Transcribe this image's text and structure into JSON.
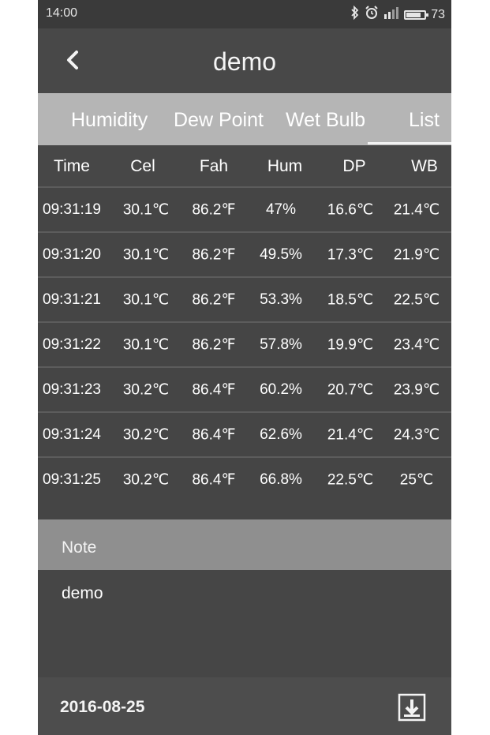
{
  "status_bar": {
    "time": "14:00",
    "battery_level": "73",
    "icons": [
      "bluetooth-icon",
      "alarm-icon",
      "signal-icon",
      "battery-icon"
    ]
  },
  "header": {
    "title": "demo"
  },
  "tabs": [
    {
      "label": "Humidity"
    },
    {
      "label": "Dew Point"
    },
    {
      "label": "Wet Bulb"
    },
    {
      "label": "List",
      "selected": true
    }
  ],
  "table": {
    "columns": [
      "Time",
      "Cel",
      "Fah",
      "Hum",
      "DP",
      "WB"
    ],
    "rows": [
      [
        "09:31:19",
        "30.1℃",
        "86.2℉",
        "47%",
        "16.6℃",
        "21.4℃"
      ],
      [
        "09:31:20",
        "30.1℃",
        "86.2℉",
        "49.5%",
        "17.3℃",
        "21.9℃"
      ],
      [
        "09:31:21",
        "30.1℃",
        "86.2℉",
        "53.3%",
        "18.5℃",
        "22.5℃"
      ],
      [
        "09:31:22",
        "30.1℃",
        "86.2℉",
        "57.8%",
        "19.9℃",
        "23.4℃"
      ],
      [
        "09:31:23",
        "30.2℃",
        "86.4℉",
        "60.2%",
        "20.7℃",
        "23.9℃"
      ],
      [
        "09:31:24",
        "30.2℃",
        "86.4℉",
        "62.6%",
        "21.4℃",
        "24.3℃"
      ],
      [
        "09:31:25",
        "30.2℃",
        "86.4℉",
        "66.8%",
        "22.5℃",
        "25℃"
      ]
    ]
  },
  "note": {
    "label": "Note",
    "text": "demo"
  },
  "footer": {
    "date": "2016-08-25"
  },
  "colors": {
    "background": "#454545",
    "tab_bar": "#b5b5b5",
    "note_header": "#8f8f8f",
    "text": "#ffffff"
  }
}
